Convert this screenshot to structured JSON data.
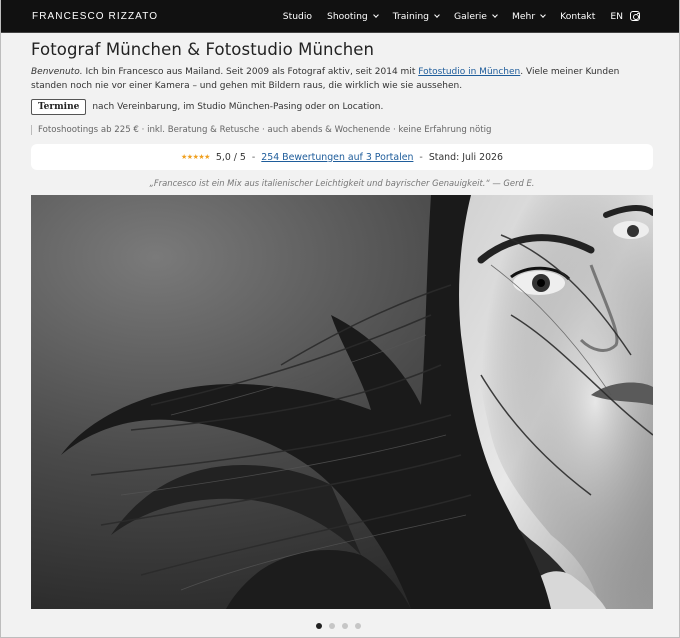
{
  "header": {
    "brand": "FRANCESCO RIZZATO",
    "nav": [
      {
        "label": "Studio",
        "dropdown": false
      },
      {
        "label": "Shooting",
        "dropdown": true
      },
      {
        "label": "Training",
        "dropdown": true
      },
      {
        "label": "Galerie",
        "dropdown": true
      },
      {
        "label": "Mehr",
        "dropdown": true
      },
      {
        "label": "Kontakt",
        "dropdown": false
      },
      {
        "label": "EN",
        "dropdown": false
      }
    ],
    "social_icon": "instagram-icon"
  },
  "main": {
    "title": "Fotograf München & Fotostudio München",
    "intro": {
      "greeting": "Benvenuto.",
      "text_before_link": " Ich bin Francesco aus Mailand. Seit 2009 als Fotograf aktiv, seit 2014 mit ",
      "link": "Fotostudio in München",
      "text_after_link": ". Viele meiner Kunden standen noch nie vor einer Kamera – und gehen mit Bildern raus, die wirklich wie sie aussehen."
    },
    "termine": {
      "button_label": "Termine",
      "text": "nach Vereinbarung, im Studio München-Pasing oder on Location."
    },
    "price_line": "Fotoshootings ab 225 € · inkl. Beratung & Retusche · auch abends & Wochenende · keine Erfahrung nötig",
    "rating": {
      "stars": "★★★★★",
      "score": "5,0 / 5",
      "separator": "-",
      "reviews_link": "254 Bewertungen auf 3 Portalen",
      "stand": "Stand: Juli 2026"
    },
    "quote": "„Francesco ist ein Mix aus italienischer Leichtigkeit und bayrischer Genauigkeit.“ — Gerd E."
  },
  "carousel": {
    "slide_count": 4,
    "active_index": 0
  }
}
